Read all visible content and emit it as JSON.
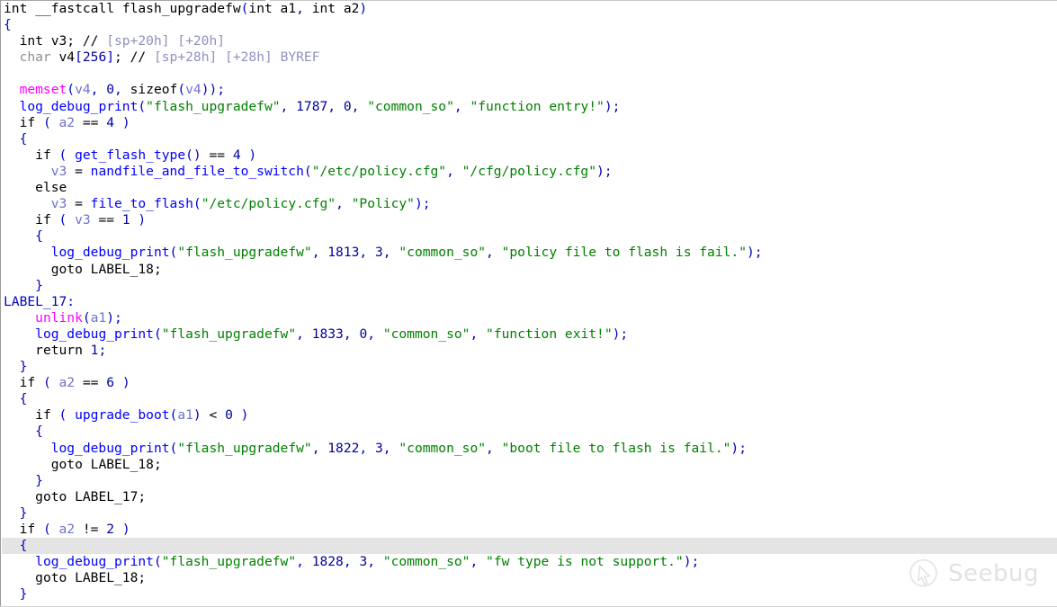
{
  "app": {
    "view": "IDA Pro Hex-Rays pseudocode",
    "function_signature": "int __fastcall flash_upgradefw(int a1, int a2)"
  },
  "theme": {
    "background": "#ffffff",
    "highlight_row": "#e4e4e4",
    "plain": "#000000",
    "punctuation": "#0000c0",
    "number": "#00009b",
    "string": "#008000",
    "user_function": "#0000ff",
    "library_function": "#ff00ff",
    "local_variable": "#7070d0",
    "comment": "#9090c0",
    "type_keyword": "#8e8e8e"
  },
  "watermark": {
    "label": "Seebug",
    "logo_icon": "seebug-cursor-logo-icon",
    "color": "#e2e2e2"
  },
  "highlighted_line_index": 33,
  "code_lines": [
    {
      "indent": 0,
      "tokens": [
        {
          "t": "int ",
          "c": "def"
        },
        {
          "t": "__fastcall ",
          "c": "def"
        },
        {
          "t": "flash_upgradefw",
          "c": "def"
        },
        {
          "t": "(",
          "c": "punct"
        },
        {
          "t": "int a1",
          "c": "def"
        },
        {
          "t": ", ",
          "c": "punct"
        },
        {
          "t": "int a2",
          "c": "def"
        },
        {
          "t": ")",
          "c": "punct"
        }
      ]
    },
    {
      "indent": 0,
      "tokens": [
        {
          "t": "{",
          "c": "punct"
        }
      ]
    },
    {
      "indent": 1,
      "tokens": [
        {
          "t": "int v3; ",
          "c": "def"
        },
        {
          "t": "// ",
          "c": "cmtm"
        },
        {
          "t": "[sp+20h] [+20h]",
          "c": "cmt"
        }
      ]
    },
    {
      "indent": 1,
      "tokens": [
        {
          "t": "char",
          "c": "type"
        },
        {
          "t": " v4",
          "c": "def"
        },
        {
          "t": "[",
          "c": "punct"
        },
        {
          "t": "256",
          "c": "num"
        },
        {
          "t": "]",
          "c": "punct"
        },
        {
          "t": "; ",
          "c": "def"
        },
        {
          "t": "// ",
          "c": "cmtm"
        },
        {
          "t": "[sp+28h] [+28h] BYREF",
          "c": "cmt"
        }
      ]
    },
    {
      "indent": 0,
      "tokens": []
    },
    {
      "indent": 1,
      "tokens": [
        {
          "t": "memset",
          "c": "lib"
        },
        {
          "t": "(",
          "c": "punct"
        },
        {
          "t": "v4",
          "c": "var"
        },
        {
          "t": ", ",
          "c": "punct"
        },
        {
          "t": "0",
          "c": "num"
        },
        {
          "t": ", ",
          "c": "punct"
        },
        {
          "t": "sizeof",
          "c": "def"
        },
        {
          "t": "(",
          "c": "punct"
        },
        {
          "t": "v4",
          "c": "var"
        },
        {
          "t": "));",
          "c": "punct"
        }
      ]
    },
    {
      "indent": 1,
      "tokens": [
        {
          "t": "log_debug_print",
          "c": "fn"
        },
        {
          "t": "(",
          "c": "punct"
        },
        {
          "t": "\"flash_upgradefw\"",
          "c": "str"
        },
        {
          "t": ", ",
          "c": "punct"
        },
        {
          "t": "1787",
          "c": "num"
        },
        {
          "t": ", ",
          "c": "punct"
        },
        {
          "t": "0",
          "c": "num"
        },
        {
          "t": ", ",
          "c": "punct"
        },
        {
          "t": "\"common_so\"",
          "c": "str"
        },
        {
          "t": ", ",
          "c": "punct"
        },
        {
          "t": "\"function entry!\"",
          "c": "str"
        },
        {
          "t": ");",
          "c": "punct"
        }
      ]
    },
    {
      "indent": 1,
      "tokens": [
        {
          "t": "if ",
          "c": "kw"
        },
        {
          "t": "( ",
          "c": "punct"
        },
        {
          "t": "a2",
          "c": "var"
        },
        {
          "t": " == ",
          "c": "def"
        },
        {
          "t": "4",
          "c": "num"
        },
        {
          "t": " )",
          "c": "punct"
        }
      ]
    },
    {
      "indent": 1,
      "tokens": [
        {
          "t": "{",
          "c": "punct"
        }
      ]
    },
    {
      "indent": 2,
      "tokens": [
        {
          "t": "if ",
          "c": "kw"
        },
        {
          "t": "( ",
          "c": "punct"
        },
        {
          "t": "get_flash_type",
          "c": "fn"
        },
        {
          "t": "()",
          "c": "punct"
        },
        {
          "t": " == ",
          "c": "def"
        },
        {
          "t": "4",
          "c": "num"
        },
        {
          "t": " )",
          "c": "punct"
        }
      ]
    },
    {
      "indent": 3,
      "tokens": [
        {
          "t": "v3",
          "c": "var"
        },
        {
          "t": " = ",
          "c": "def"
        },
        {
          "t": "nandfile_and_file_to_switch",
          "c": "fn"
        },
        {
          "t": "(",
          "c": "punct"
        },
        {
          "t": "\"/etc/policy.cfg\"",
          "c": "str"
        },
        {
          "t": ", ",
          "c": "punct"
        },
        {
          "t": "\"/cfg/policy.cfg\"",
          "c": "str"
        },
        {
          "t": ");",
          "c": "punct"
        }
      ]
    },
    {
      "indent": 2,
      "tokens": [
        {
          "t": "else",
          "c": "kw"
        }
      ]
    },
    {
      "indent": 3,
      "tokens": [
        {
          "t": "v3",
          "c": "var"
        },
        {
          "t": " = ",
          "c": "def"
        },
        {
          "t": "file_to_flash",
          "c": "fn"
        },
        {
          "t": "(",
          "c": "punct"
        },
        {
          "t": "\"/etc/policy.cfg\"",
          "c": "str"
        },
        {
          "t": ", ",
          "c": "punct"
        },
        {
          "t": "\"Policy\"",
          "c": "str"
        },
        {
          "t": ");",
          "c": "punct"
        }
      ]
    },
    {
      "indent": 2,
      "tokens": [
        {
          "t": "if ",
          "c": "kw"
        },
        {
          "t": "( ",
          "c": "punct"
        },
        {
          "t": "v3",
          "c": "var"
        },
        {
          "t": " == ",
          "c": "def"
        },
        {
          "t": "1",
          "c": "num"
        },
        {
          "t": " )",
          "c": "punct"
        }
      ]
    },
    {
      "indent": 2,
      "tokens": [
        {
          "t": "{",
          "c": "punct"
        }
      ]
    },
    {
      "indent": 3,
      "tokens": [
        {
          "t": "log_debug_print",
          "c": "fn"
        },
        {
          "t": "(",
          "c": "punct"
        },
        {
          "t": "\"flash_upgradefw\"",
          "c": "str"
        },
        {
          "t": ", ",
          "c": "punct"
        },
        {
          "t": "1813",
          "c": "num"
        },
        {
          "t": ", ",
          "c": "punct"
        },
        {
          "t": "3",
          "c": "num"
        },
        {
          "t": ", ",
          "c": "punct"
        },
        {
          "t": "\"common_so\"",
          "c": "str"
        },
        {
          "t": ", ",
          "c": "punct"
        },
        {
          "t": "\"policy file to flash is fail.\"",
          "c": "str"
        },
        {
          "t": ");",
          "c": "punct"
        }
      ]
    },
    {
      "indent": 3,
      "tokens": [
        {
          "t": "goto ",
          "c": "kw"
        },
        {
          "t": "LABEL_18;",
          "c": "def"
        }
      ]
    },
    {
      "indent": 2,
      "tokens": [
        {
          "t": "}",
          "c": "punct"
        }
      ]
    },
    {
      "indent": -1,
      "tokens": [
        {
          "t": "LABEL_17:",
          "c": "label"
        }
      ]
    },
    {
      "indent": 2,
      "tokens": [
        {
          "t": "unlink",
          "c": "lib"
        },
        {
          "t": "(",
          "c": "punct"
        },
        {
          "t": "a1",
          "c": "var"
        },
        {
          "t": ");",
          "c": "punct"
        }
      ]
    },
    {
      "indent": 2,
      "tokens": [
        {
          "t": "log_debug_print",
          "c": "fn"
        },
        {
          "t": "(",
          "c": "punct"
        },
        {
          "t": "\"flash_upgradefw\"",
          "c": "str"
        },
        {
          "t": ", ",
          "c": "punct"
        },
        {
          "t": "1833",
          "c": "num"
        },
        {
          "t": ", ",
          "c": "punct"
        },
        {
          "t": "0",
          "c": "num"
        },
        {
          "t": ", ",
          "c": "punct"
        },
        {
          "t": "\"common_so\"",
          "c": "str"
        },
        {
          "t": ", ",
          "c": "punct"
        },
        {
          "t": "\"function exit!\"",
          "c": "str"
        },
        {
          "t": ");",
          "c": "punct"
        }
      ]
    },
    {
      "indent": 2,
      "tokens": [
        {
          "t": "return ",
          "c": "kw"
        },
        {
          "t": "1",
          "c": "num"
        },
        {
          "t": ";",
          "c": "punct"
        }
      ]
    },
    {
      "indent": 1,
      "tokens": [
        {
          "t": "}",
          "c": "punct"
        }
      ]
    },
    {
      "indent": 1,
      "tokens": [
        {
          "t": "if ",
          "c": "kw"
        },
        {
          "t": "( ",
          "c": "punct"
        },
        {
          "t": "a2",
          "c": "var"
        },
        {
          "t": " == ",
          "c": "def"
        },
        {
          "t": "6",
          "c": "num"
        },
        {
          "t": " )",
          "c": "punct"
        }
      ]
    },
    {
      "indent": 1,
      "tokens": [
        {
          "t": "{",
          "c": "punct"
        }
      ]
    },
    {
      "indent": 2,
      "tokens": [
        {
          "t": "if ",
          "c": "kw"
        },
        {
          "t": "( ",
          "c": "punct"
        },
        {
          "t": "upgrade_boot",
          "c": "fn"
        },
        {
          "t": "(",
          "c": "punct"
        },
        {
          "t": "a1",
          "c": "var"
        },
        {
          "t": ")",
          "c": "punct"
        },
        {
          "t": " < ",
          "c": "def"
        },
        {
          "t": "0",
          "c": "num"
        },
        {
          "t": " )",
          "c": "punct"
        }
      ]
    },
    {
      "indent": 2,
      "tokens": [
        {
          "t": "{",
          "c": "punct"
        }
      ]
    },
    {
      "indent": 3,
      "tokens": [
        {
          "t": "log_debug_print",
          "c": "fn"
        },
        {
          "t": "(",
          "c": "punct"
        },
        {
          "t": "\"flash_upgradefw\"",
          "c": "str"
        },
        {
          "t": ", ",
          "c": "punct"
        },
        {
          "t": "1822",
          "c": "num"
        },
        {
          "t": ", ",
          "c": "punct"
        },
        {
          "t": "3",
          "c": "num"
        },
        {
          "t": ", ",
          "c": "punct"
        },
        {
          "t": "\"common_so\"",
          "c": "str"
        },
        {
          "t": ", ",
          "c": "punct"
        },
        {
          "t": "\"boot file to flash is fail.\"",
          "c": "str"
        },
        {
          "t": ");",
          "c": "punct"
        }
      ]
    },
    {
      "indent": 3,
      "tokens": [
        {
          "t": "goto ",
          "c": "kw"
        },
        {
          "t": "LABEL_18;",
          "c": "def"
        }
      ]
    },
    {
      "indent": 2,
      "tokens": [
        {
          "t": "}",
          "c": "punct"
        }
      ]
    },
    {
      "indent": 2,
      "tokens": [
        {
          "t": "goto ",
          "c": "kw"
        },
        {
          "t": "LABEL_17;",
          "c": "def"
        }
      ]
    },
    {
      "indent": 1,
      "tokens": [
        {
          "t": "}",
          "c": "punct"
        }
      ]
    },
    {
      "indent": 1,
      "tokens": [
        {
          "t": "if ",
          "c": "kw"
        },
        {
          "t": "( ",
          "c": "punct"
        },
        {
          "t": "a2",
          "c": "var"
        },
        {
          "t": " != ",
          "c": "def"
        },
        {
          "t": "2",
          "c": "num"
        },
        {
          "t": " )",
          "c": "punct"
        }
      ]
    },
    {
      "indent": 1,
      "tokens": [
        {
          "t": "{",
          "c": "punct"
        }
      ]
    },
    {
      "indent": 2,
      "tokens": [
        {
          "t": "log_debug_print",
          "c": "fn"
        },
        {
          "t": "(",
          "c": "punct"
        },
        {
          "t": "\"flash_upgradefw\"",
          "c": "str"
        },
        {
          "t": ", ",
          "c": "punct"
        },
        {
          "t": "1828",
          "c": "num"
        },
        {
          "t": ", ",
          "c": "punct"
        },
        {
          "t": "3",
          "c": "num"
        },
        {
          "t": ", ",
          "c": "punct"
        },
        {
          "t": "\"common_so\"",
          "c": "str"
        },
        {
          "t": ", ",
          "c": "punct"
        },
        {
          "t": "\"fw type is not support.\"",
          "c": "str"
        },
        {
          "t": ");",
          "c": "punct"
        }
      ]
    },
    {
      "indent": 2,
      "tokens": [
        {
          "t": "goto ",
          "c": "kw"
        },
        {
          "t": "LABEL_18;",
          "c": "def"
        }
      ]
    },
    {
      "indent": 1,
      "tokens": [
        {
          "t": "}",
          "c": "punct"
        }
      ]
    }
  ]
}
